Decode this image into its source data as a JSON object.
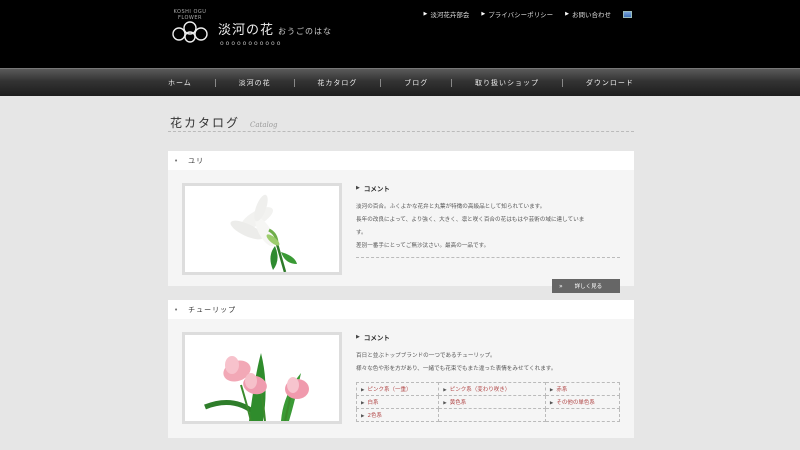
{
  "header": {
    "logo_arc": "KOSHI OGU FLOWER",
    "logo_title": "淡河の花",
    "logo_kana": "おうごのはな",
    "logo_sub": "ooooooooooo"
  },
  "topnav": {
    "items": [
      {
        "label": "淡河花卉部会"
      },
      {
        "label": "プライバシーポリシー"
      },
      {
        "label": "お問い合わせ"
      }
    ]
  },
  "mainnav": {
    "items": [
      {
        "label": "ホーム"
      },
      {
        "label": "淡河の花"
      },
      {
        "label": "花カタログ"
      },
      {
        "label": "ブログ"
      },
      {
        "label": "取り扱いショップ"
      },
      {
        "label": "ダウンロード"
      }
    ]
  },
  "page": {
    "title": "花カタログ",
    "title_en": "Catalog"
  },
  "cards": [
    {
      "name": "ユリ",
      "comment_label": "コメント",
      "lines": [
        "淡河の百合。ふくよかな花弁と丸葉が特徴の高級品として知られています。",
        "長年の改良によって、より強く、大きく、凛と咲く百合の花はもはや芸術の域に達していま",
        "す。",
        "差別一番手にとってご無沙汰さい。最高の一品です。"
      ],
      "detail_button": "詳しく見る"
    },
    {
      "name": "チューリップ",
      "comment_label": "コメント",
      "lines": [
        "百日と並ぶトップブランドの一つであるチューリップ。",
        "様々な色や形を方があり、一緒でも花束でもまた違った表情をみせてくれます。"
      ],
      "varieties": [
        [
          "ピンク系（一重）",
          "ピンク系（変わり咲き）",
          "赤系"
        ],
        [
          "白系",
          "黄色系",
          "その他の単色系"
        ],
        [
          "2色系",
          "",
          ""
        ]
      ]
    }
  ],
  "colors": {
    "header_bg": "#000000",
    "page_bg": "#e6e6e6",
    "link_red": "#b04444",
    "button_bg": "#666666"
  }
}
